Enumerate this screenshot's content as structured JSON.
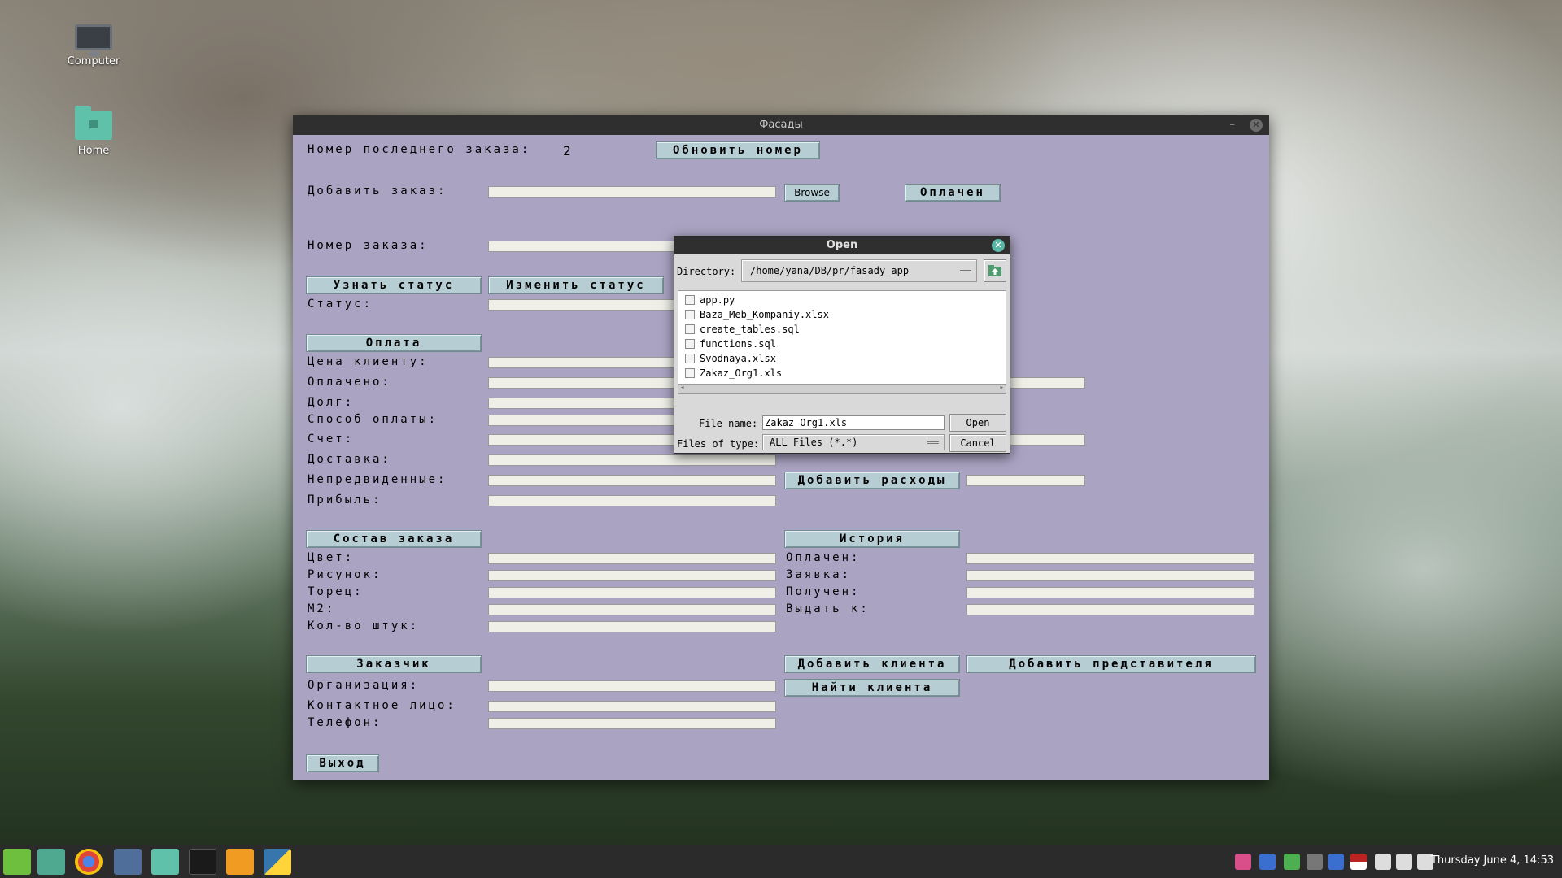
{
  "desktop": {
    "icons": [
      {
        "label": "Computer"
      },
      {
        "label": "Home"
      }
    ]
  },
  "window": {
    "title": "Фасады",
    "last_order_label": "Номер последнего заказа:",
    "last_order_value": "2",
    "refresh_button": "Обновить номер",
    "add_order_label": "Добавить заказ:",
    "browse_button": "Browse",
    "paid_button": "Оплачен",
    "order_number_label": "Номер заказа:",
    "check_status_button": "Узнать статус",
    "change_status_button": "Изменить статус",
    "status_label": "Статус:",
    "payment_header": "Оплата",
    "payment_fields": [
      "Цена клиенту:",
      "Оплачено:",
      "Долг:",
      "Способ оплаты:",
      "Счет:",
      "Доставка:",
      "Непредвиденные:",
      "Прибыль:"
    ],
    "add_expenses_button": "Добавить расходы",
    "order_composition_header": "Состав заказа",
    "composition_fields": [
      "Цвет:",
      "Рисунок:",
      "Торец:",
      "М2:",
      "Кол-во штук:"
    ],
    "history_header": "История",
    "history_fields": [
      "Оплачен:",
      "Заявка:",
      "Получен:",
      "Выдать к:"
    ],
    "customer_header": "Заказчик",
    "customer_fields": [
      "Организация:",
      "Контактное лицо:",
      "Телефон:"
    ],
    "add_client_button": "Добавить клиента",
    "add_representative_button": "Добавить представителя",
    "find_client_button": "Найти клиента",
    "exit_button": "Выход"
  },
  "open_dialog": {
    "title": "Open",
    "directory_label": "Directory:",
    "directory_value": "/home/yana/DB/pr/fasady_app",
    "files": [
      "app.py",
      "Baza_Meb_Kompaniy.xlsx",
      "create_tables.sql",
      "functions.sql",
      "Svodnaya.xlsx",
      "Zakaz_Org1.xls"
    ],
    "file_name_label": "File name:",
    "file_name_value": "Zakaz_Org1.xls",
    "files_of_type_label": "Files of type:",
    "files_of_type_value": "ALL Files (*.*)",
    "open_button": "Open",
    "cancel_button": "Cancel"
  },
  "taskbar": {
    "clock": "Thursday June 4, 14:53"
  }
}
